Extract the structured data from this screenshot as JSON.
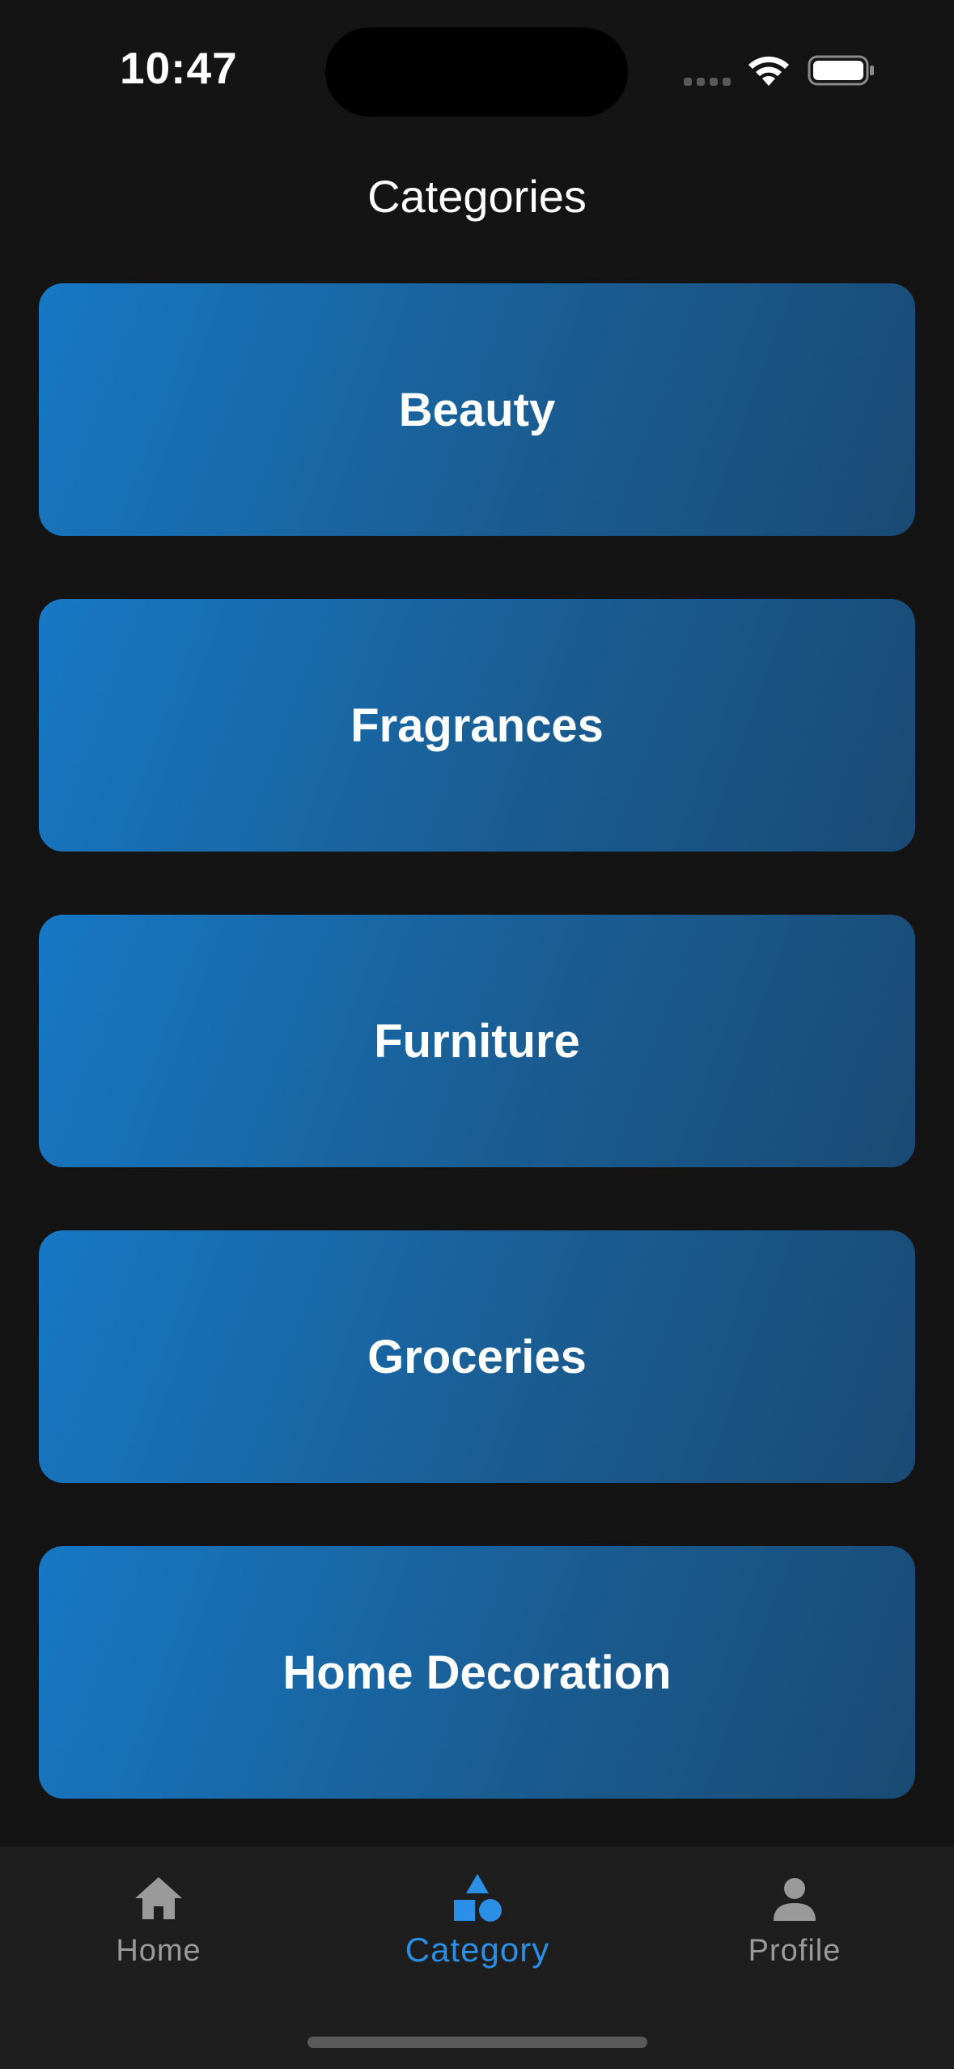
{
  "status_bar": {
    "time": "10:47"
  },
  "header": {
    "title": "Categories"
  },
  "categories": [
    {
      "label": "Beauty"
    },
    {
      "label": "Fragrances"
    },
    {
      "label": "Furniture"
    },
    {
      "label": "Groceries"
    },
    {
      "label": "Home Decoration"
    }
  ],
  "bottom_nav": {
    "items": [
      {
        "label": "Home",
        "icon": "home-icon",
        "active": false
      },
      {
        "label": "Category",
        "icon": "category-shapes-icon",
        "active": true
      },
      {
        "label": "Profile",
        "icon": "person-icon",
        "active": false
      }
    ]
  },
  "colors": {
    "background": "#141414",
    "card_gradient_start": "#1778c4",
    "card_gradient_end": "#1a4a74",
    "accent": "#2b8fe6",
    "nav_inactive": "#9a9a9a",
    "nav_background": "#1e1e1e"
  }
}
